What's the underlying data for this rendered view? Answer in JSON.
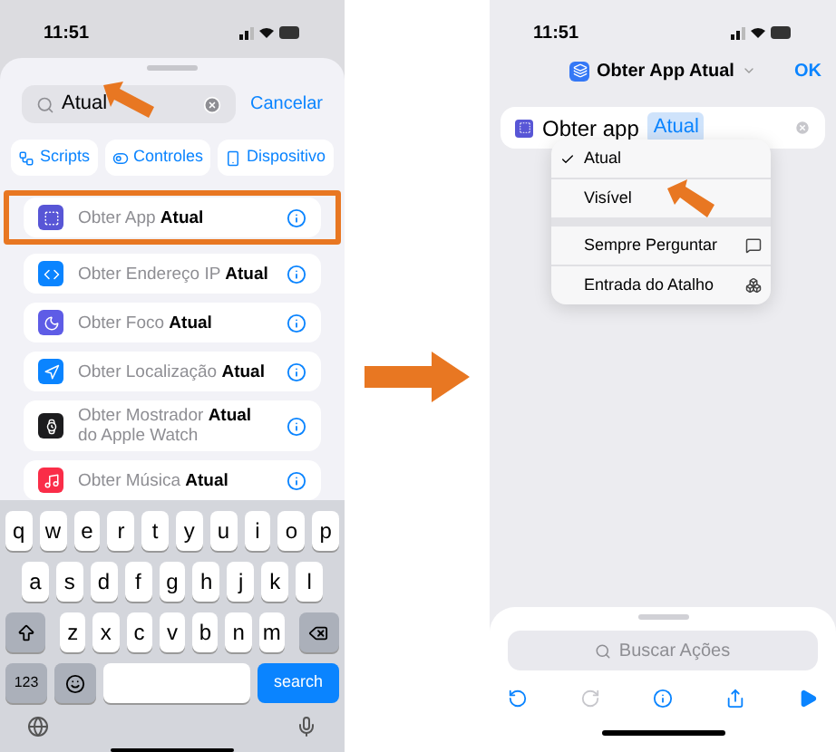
{
  "left_phone": {
    "status_time": "11:51",
    "search": {
      "value": "Atual",
      "cancel": "Cancelar"
    },
    "chips": [
      {
        "label": "Scripts",
        "kind": "scripts"
      },
      {
        "label": "Controles",
        "kind": "controls"
      },
      {
        "label": "Dispositivo",
        "kind": "device"
      }
    ],
    "results": [
      {
        "title": "Obter App **Atual**",
        "kind": "app",
        "highlighted": true
      },
      {
        "title": "Obter Endereço IP **Atual**",
        "kind": "ip",
        "highlighted": false
      },
      {
        "title": "Obter Foco **Atual**",
        "kind": "focus",
        "highlighted": false
      },
      {
        "title": "Obter Localização **Atual**",
        "kind": "location",
        "highlighted": false
      },
      {
        "title": "Obter Mostrador **Atual** do Apple Watch",
        "kind": "watch",
        "highlighted": false
      },
      {
        "title": "Obter Música **Atual**",
        "kind": "music",
        "highlighted": false
      }
    ],
    "keyboard": {
      "rows": [
        [
          "q",
          "w",
          "e",
          "r",
          "t",
          "y",
          "u",
          "i",
          "o",
          "p"
        ],
        [
          "a",
          "s",
          "d",
          "f",
          "g",
          "h",
          "j",
          "k",
          "l"
        ],
        [
          "z",
          "x",
          "c",
          "v",
          "b",
          "n",
          "m"
        ]
      ],
      "numbers_key": "123",
      "action_key": "search"
    }
  },
  "right_phone": {
    "status_time": "11:51",
    "title": "Obter App Atual",
    "done": "OK",
    "action": {
      "label": "Obter app",
      "token": "Atual"
    },
    "menu": [
      {
        "label": "Atual",
        "kind": "option",
        "selected": true
      },
      {
        "label": "Visível",
        "kind": "option",
        "selected": false
      },
      {
        "label": "Sempre Perguntar",
        "kind": "ask",
        "selected": false
      },
      {
        "label": "Entrada do Atalho",
        "kind": "input",
        "selected": false
      }
    ],
    "search_placeholder": "Buscar Ações",
    "toolbar": [
      {
        "kind": "undo",
        "disabled": false
      },
      {
        "kind": "redo",
        "disabled": true
      },
      {
        "kind": "info",
        "disabled": false
      },
      {
        "kind": "share",
        "disabled": false
      },
      {
        "kind": "run",
        "disabled": false
      }
    ]
  }
}
